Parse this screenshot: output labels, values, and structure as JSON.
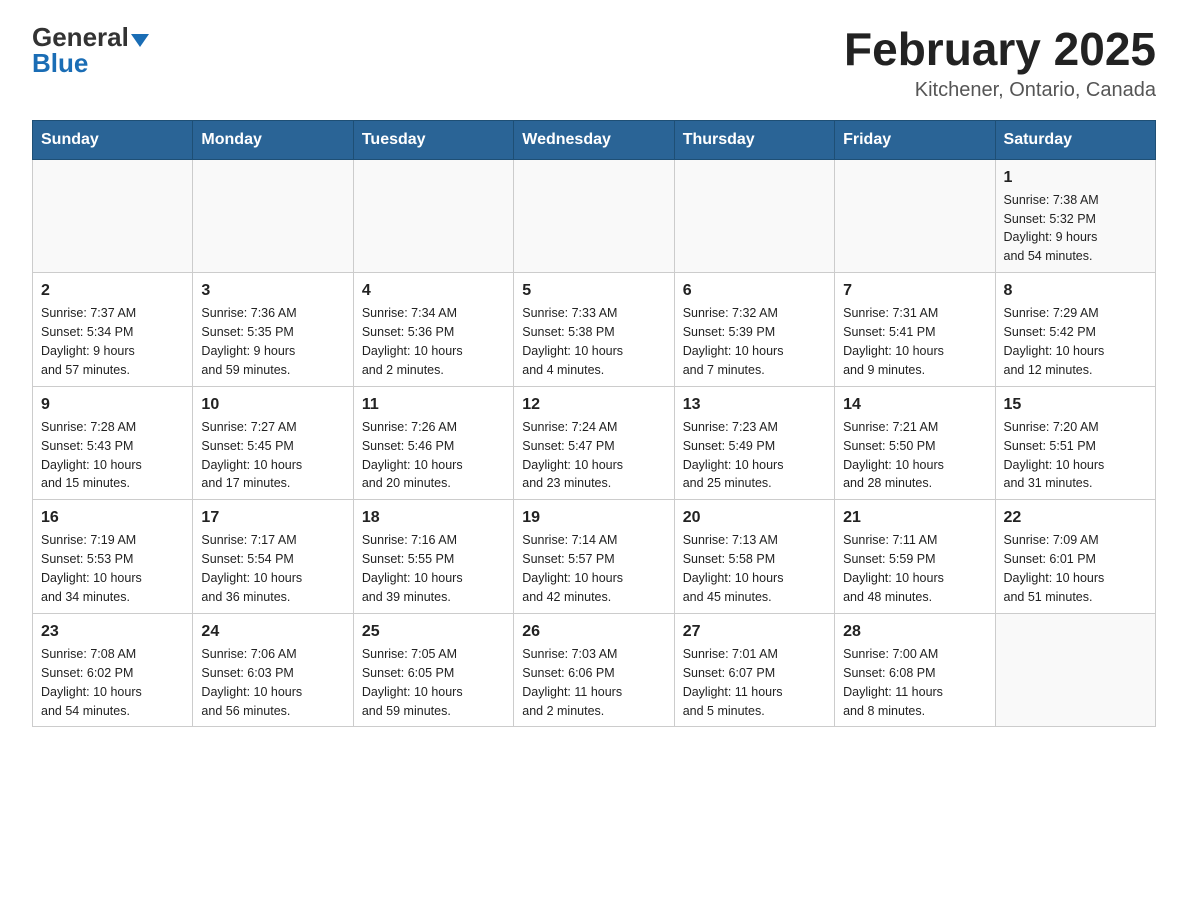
{
  "header": {
    "logo_general": "General",
    "logo_blue": "Blue",
    "title": "February 2025",
    "subtitle": "Kitchener, Ontario, Canada"
  },
  "weekdays": [
    "Sunday",
    "Monday",
    "Tuesday",
    "Wednesday",
    "Thursday",
    "Friday",
    "Saturday"
  ],
  "weeks": [
    [
      {
        "day": "",
        "info": ""
      },
      {
        "day": "",
        "info": ""
      },
      {
        "day": "",
        "info": ""
      },
      {
        "day": "",
        "info": ""
      },
      {
        "day": "",
        "info": ""
      },
      {
        "day": "",
        "info": ""
      },
      {
        "day": "1",
        "info": "Sunrise: 7:38 AM\nSunset: 5:32 PM\nDaylight: 9 hours\nand 54 minutes."
      }
    ],
    [
      {
        "day": "2",
        "info": "Sunrise: 7:37 AM\nSunset: 5:34 PM\nDaylight: 9 hours\nand 57 minutes."
      },
      {
        "day": "3",
        "info": "Sunrise: 7:36 AM\nSunset: 5:35 PM\nDaylight: 9 hours\nand 59 minutes."
      },
      {
        "day": "4",
        "info": "Sunrise: 7:34 AM\nSunset: 5:36 PM\nDaylight: 10 hours\nand 2 minutes."
      },
      {
        "day": "5",
        "info": "Sunrise: 7:33 AM\nSunset: 5:38 PM\nDaylight: 10 hours\nand 4 minutes."
      },
      {
        "day": "6",
        "info": "Sunrise: 7:32 AM\nSunset: 5:39 PM\nDaylight: 10 hours\nand 7 minutes."
      },
      {
        "day": "7",
        "info": "Sunrise: 7:31 AM\nSunset: 5:41 PM\nDaylight: 10 hours\nand 9 minutes."
      },
      {
        "day": "8",
        "info": "Sunrise: 7:29 AM\nSunset: 5:42 PM\nDaylight: 10 hours\nand 12 minutes."
      }
    ],
    [
      {
        "day": "9",
        "info": "Sunrise: 7:28 AM\nSunset: 5:43 PM\nDaylight: 10 hours\nand 15 minutes."
      },
      {
        "day": "10",
        "info": "Sunrise: 7:27 AM\nSunset: 5:45 PM\nDaylight: 10 hours\nand 17 minutes."
      },
      {
        "day": "11",
        "info": "Sunrise: 7:26 AM\nSunset: 5:46 PM\nDaylight: 10 hours\nand 20 minutes."
      },
      {
        "day": "12",
        "info": "Sunrise: 7:24 AM\nSunset: 5:47 PM\nDaylight: 10 hours\nand 23 minutes."
      },
      {
        "day": "13",
        "info": "Sunrise: 7:23 AM\nSunset: 5:49 PM\nDaylight: 10 hours\nand 25 minutes."
      },
      {
        "day": "14",
        "info": "Sunrise: 7:21 AM\nSunset: 5:50 PM\nDaylight: 10 hours\nand 28 minutes."
      },
      {
        "day": "15",
        "info": "Sunrise: 7:20 AM\nSunset: 5:51 PM\nDaylight: 10 hours\nand 31 minutes."
      }
    ],
    [
      {
        "day": "16",
        "info": "Sunrise: 7:19 AM\nSunset: 5:53 PM\nDaylight: 10 hours\nand 34 minutes."
      },
      {
        "day": "17",
        "info": "Sunrise: 7:17 AM\nSunset: 5:54 PM\nDaylight: 10 hours\nand 36 minutes."
      },
      {
        "day": "18",
        "info": "Sunrise: 7:16 AM\nSunset: 5:55 PM\nDaylight: 10 hours\nand 39 minutes."
      },
      {
        "day": "19",
        "info": "Sunrise: 7:14 AM\nSunset: 5:57 PM\nDaylight: 10 hours\nand 42 minutes."
      },
      {
        "day": "20",
        "info": "Sunrise: 7:13 AM\nSunset: 5:58 PM\nDaylight: 10 hours\nand 45 minutes."
      },
      {
        "day": "21",
        "info": "Sunrise: 7:11 AM\nSunset: 5:59 PM\nDaylight: 10 hours\nand 48 minutes."
      },
      {
        "day": "22",
        "info": "Sunrise: 7:09 AM\nSunset: 6:01 PM\nDaylight: 10 hours\nand 51 minutes."
      }
    ],
    [
      {
        "day": "23",
        "info": "Sunrise: 7:08 AM\nSunset: 6:02 PM\nDaylight: 10 hours\nand 54 minutes."
      },
      {
        "day": "24",
        "info": "Sunrise: 7:06 AM\nSunset: 6:03 PM\nDaylight: 10 hours\nand 56 minutes."
      },
      {
        "day": "25",
        "info": "Sunrise: 7:05 AM\nSunset: 6:05 PM\nDaylight: 10 hours\nand 59 minutes."
      },
      {
        "day": "26",
        "info": "Sunrise: 7:03 AM\nSunset: 6:06 PM\nDaylight: 11 hours\nand 2 minutes."
      },
      {
        "day": "27",
        "info": "Sunrise: 7:01 AM\nSunset: 6:07 PM\nDaylight: 11 hours\nand 5 minutes."
      },
      {
        "day": "28",
        "info": "Sunrise: 7:00 AM\nSunset: 6:08 PM\nDaylight: 11 hours\nand 8 minutes."
      },
      {
        "day": "",
        "info": ""
      }
    ]
  ]
}
